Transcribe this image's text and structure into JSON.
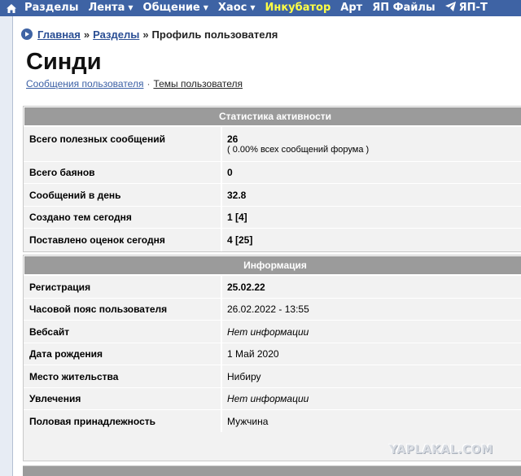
{
  "nav": {
    "items": [
      {
        "label": "Разделы",
        "caret": false,
        "highlight": false
      },
      {
        "label": "Лента",
        "caret": true,
        "highlight": false
      },
      {
        "label": "Общение",
        "caret": true,
        "highlight": false
      },
      {
        "label": "Хаос",
        "caret": true,
        "highlight": false
      },
      {
        "label": "Инкубатор",
        "caret": false,
        "highlight": true
      },
      {
        "label": "Арт",
        "caret": false,
        "highlight": false
      },
      {
        "label": "ЯП Файлы",
        "caret": false,
        "highlight": false
      },
      {
        "label": "ЯП-Т",
        "caret": false,
        "highlight": false
      }
    ]
  },
  "breadcrumb": {
    "home": "Главная",
    "sections": "Разделы",
    "separator": "»",
    "current": "Профиль пользователя"
  },
  "profile": {
    "name": "Синди",
    "link_messages": "Сообщения пользователя",
    "dot": "·",
    "link_topics": "Темы пользователя"
  },
  "stats": {
    "header": "Статистика активности",
    "rows": [
      {
        "label": "Всего полезных сообщений",
        "value": "26",
        "note": "( 0.00% всех сообщений форума )"
      },
      {
        "label": "Всего баянов",
        "value": "0"
      },
      {
        "label": "Сообщений в день",
        "value": "32.8"
      },
      {
        "label": "Создано тем сегодня",
        "value": "1 [4]"
      },
      {
        "label": "Поставлено оценок сегодня",
        "value": "4 [25]"
      }
    ]
  },
  "info": {
    "header": "Информация",
    "rows": [
      {
        "label": "Регистрация",
        "value": "25.02.22",
        "style": "bold"
      },
      {
        "label": "Часовой пояс пользователя",
        "value": "26.02.2022 - 13:55",
        "style": "normal"
      },
      {
        "label": "Вебсайт",
        "value": "Нет информации",
        "style": "italic"
      },
      {
        "label": "Дата рождения",
        "value": "1 Май 2020",
        "style": "normal"
      },
      {
        "label": "Место жительства",
        "value": "Нибиру",
        "style": "normal"
      },
      {
        "label": "Увлечения",
        "value": "Нет информации",
        "style": "italic"
      },
      {
        "label": "Половая принадлежность",
        "value": "Мужчина",
        "style": "normal"
      }
    ]
  },
  "watermark": "YAPLAKAL.COM",
  "colors": {
    "nav_bg": "#3e63a4",
    "nav_highlight": "#ffff44",
    "panel_header_bg": "#9b9b9b",
    "panel_bg": "#f2f2f2",
    "link": "#2a4e94"
  },
  "icons": [
    "home-icon",
    "chevron-down-icon",
    "paper-plane-icon",
    "bullet-arrow-icon"
  ]
}
